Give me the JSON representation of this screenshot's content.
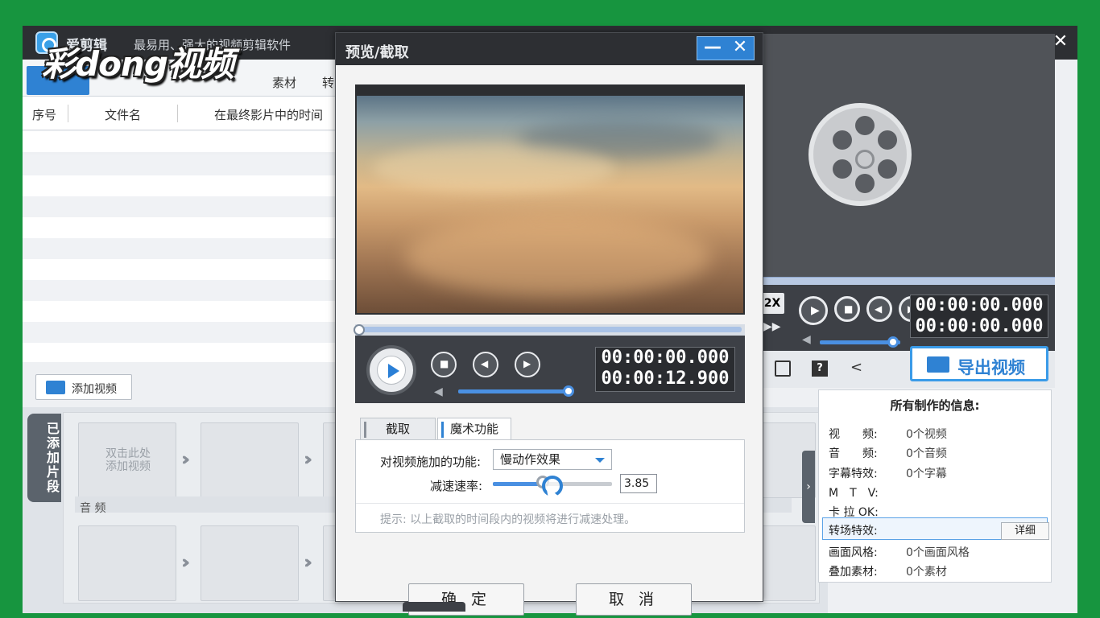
{
  "app": {
    "name": "爱剪辑",
    "slogan": "最易用、强大的视频剪辑软件",
    "watermark": "彩dong视频",
    "window_controls": {
      "minimize": "—",
      "maximize": "□",
      "close": "✕"
    }
  },
  "toolbar": {
    "tab_material": "素材",
    "tab_convert": "转"
  },
  "list": {
    "columns": [
      "序号",
      "文件名",
      "在最终影片中的时间"
    ]
  },
  "add_video_button": "添加视频",
  "added_clips": {
    "tab_label": "已添加片段",
    "first_slot_hint": "双击此处\n添加视频",
    "audio_label": "音 频"
  },
  "main_preview": {
    "speed": "2X",
    "time_current": "00:00:00.000",
    "time_total": "00:00:00.000",
    "volume": 0.9
  },
  "export_button": "导出视频",
  "info_panel": {
    "title": "所有制作的信息:",
    "rows": [
      {
        "key": "视　　频:",
        "value": "0个视频"
      },
      {
        "key": "音　　频:",
        "value": "0个音频"
      },
      {
        "key": "字幕特效:",
        "value": "0个字幕"
      },
      {
        "key": "M　T　V:",
        "value": ""
      },
      {
        "key": "卡 拉 OK:",
        "value": ""
      },
      {
        "key": "转场特效:",
        "value": ""
      },
      {
        "key": "画面风格:",
        "value": "0个画面风格"
      },
      {
        "key": "叠加素材:",
        "value": "0个素材"
      }
    ],
    "detail_button": "详细"
  },
  "dialog": {
    "title": "预览/截取",
    "minimize": "—",
    "close": "✕",
    "time_current": "00:00:00.000",
    "time_total": "00:00:12.900",
    "volume": 1.0,
    "playback_progress": 0.0,
    "tabs": [
      "截取",
      "魔术功能"
    ],
    "active_tab": "魔术功能",
    "function_label": "对视频施加的功能:",
    "function_value": "慢动作效果",
    "rate_label": "减速速率:",
    "rate_value": "3.85",
    "rate_slider": 0.42,
    "hint": "提示: 以上截取的时间段内的视频将进行减速处理。",
    "ok_button": "确 定",
    "cancel_button": "取 消"
  },
  "colors": {
    "background": "#17953f",
    "accent": "#2f82d3",
    "titlebar": "#2d2f33"
  }
}
